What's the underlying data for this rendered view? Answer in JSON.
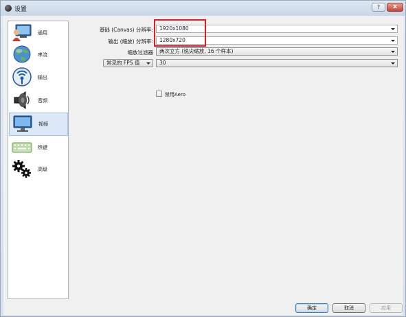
{
  "window": {
    "title": "设置",
    "help_label": "?",
    "close_label": "x"
  },
  "sidebar": {
    "items": [
      {
        "label": "通用",
        "icon": "monitor-person-icon",
        "active": false
      },
      {
        "label": "串流",
        "icon": "globe-icon",
        "active": false
      },
      {
        "label": "输出",
        "icon": "broadcast-icon",
        "active": false
      },
      {
        "label": "音频",
        "icon": "speaker-icon",
        "active": false
      },
      {
        "label": "视频",
        "icon": "monitor-icon",
        "active": true
      },
      {
        "label": "热键",
        "icon": "keyboard-icon",
        "active": false
      },
      {
        "label": "高级",
        "icon": "gears-icon",
        "active": false
      }
    ]
  },
  "video": {
    "base_resolution_label": "基础 (Canvas) 分辨率:",
    "base_resolution_value": "1920x1080",
    "output_resolution_label": "输出 (缩放) 分辨率:",
    "output_resolution_value": "1280x720",
    "downscale_filter_label": "缩放过滤器",
    "downscale_filter_value": "两次立方 (锐尖缩放, 16 个样本)",
    "fps_type_label": "常见的 FPS 值",
    "fps_value": "30",
    "disable_aero_label": "禁用Aero",
    "disable_aero_checked": false
  },
  "buttons": {
    "ok": "确定",
    "cancel": "取消",
    "apply": "应用"
  },
  "colors": {
    "highlight": "#e01b24",
    "active_item": "#dbe8f7"
  }
}
